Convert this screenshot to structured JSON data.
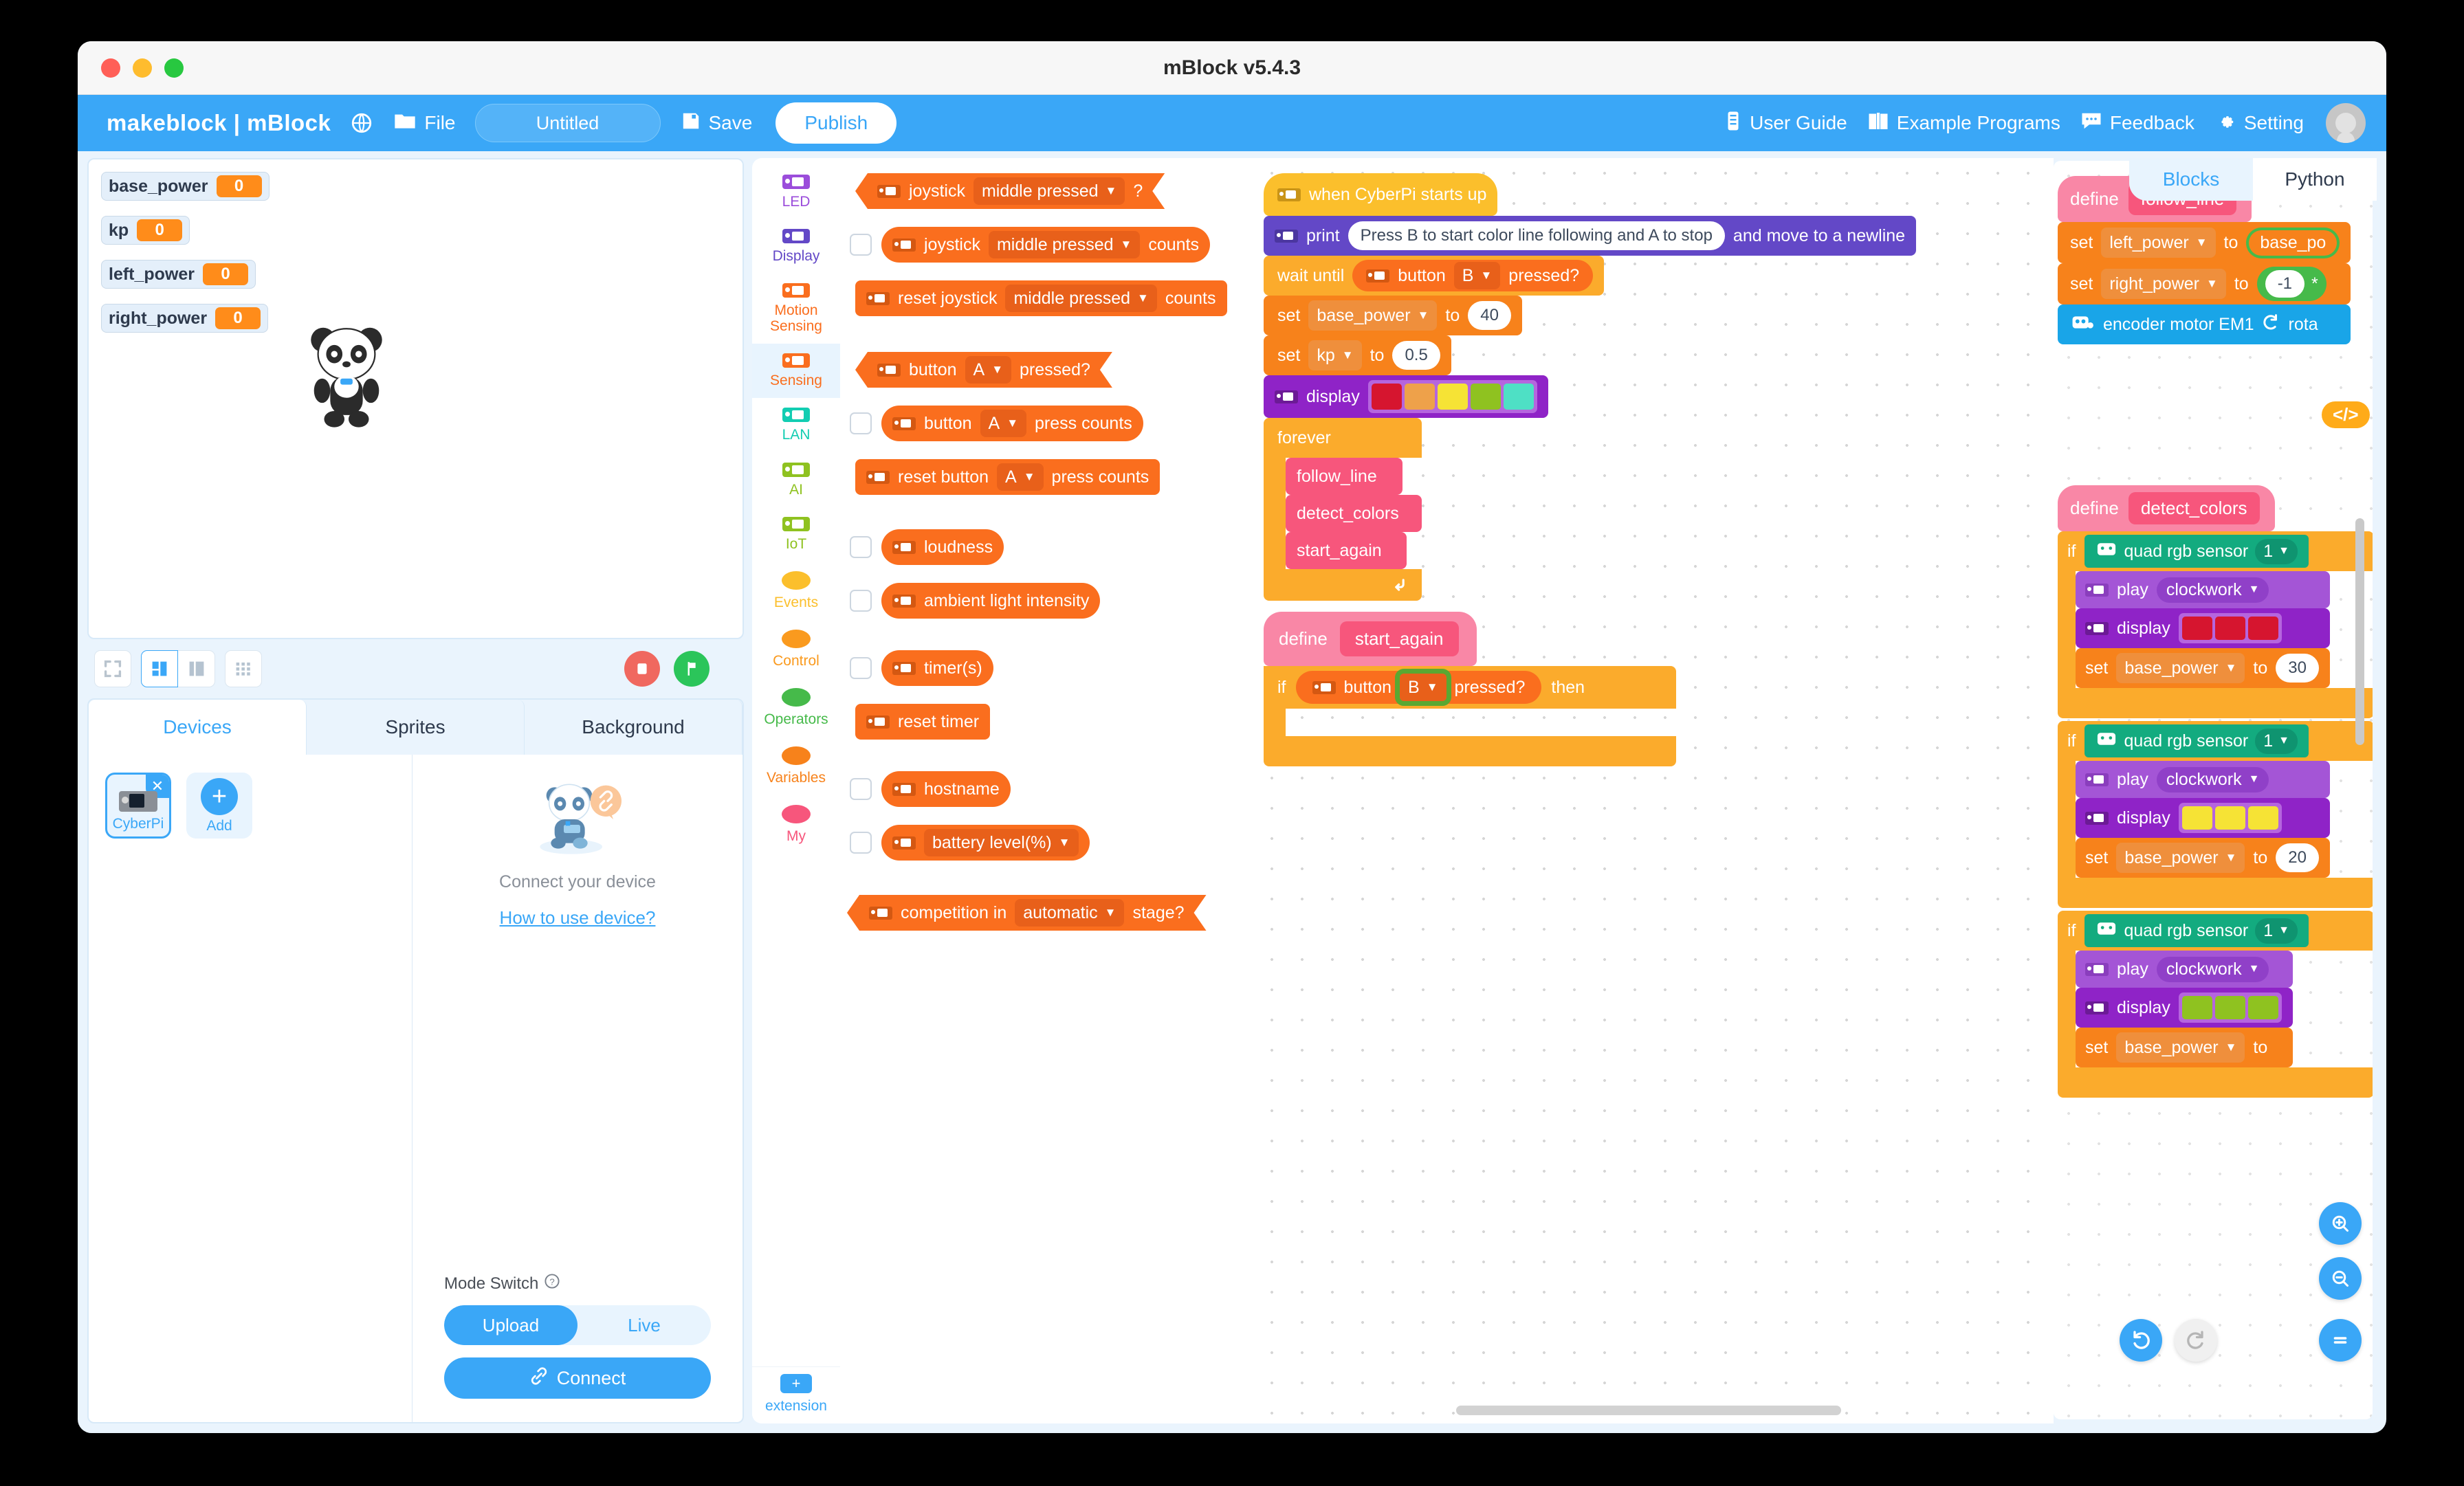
{
  "window": {
    "title": "mBlock v5.4.3"
  },
  "header": {
    "brand": "makeblock | mBlock",
    "globe_icon": "globe-icon",
    "file_icon": "folder-icon",
    "file_label": "File",
    "project_name": "Untitled",
    "project_placeholder": "Untitled",
    "save_icon": "save-icon",
    "save_label": "Save",
    "publish_label": "Publish",
    "right_items": [
      {
        "icon": "document-icon",
        "label": "User Guide"
      },
      {
        "icon": "book-icon",
        "label": "Example Programs"
      },
      {
        "icon": "chat-icon",
        "label": "Feedback"
      },
      {
        "icon": "gear-icon",
        "label": "Setting"
      }
    ]
  },
  "stage": {
    "monitors": [
      {
        "name": "base_power",
        "value": "0"
      },
      {
        "name": "kp",
        "value": "0"
      },
      {
        "name": "left_power",
        "value": "0"
      },
      {
        "name": "right_power",
        "value": "0"
      }
    ],
    "sprite": "panda-sprite",
    "controls": {
      "fullscreen_icon": "fullscreen-icon",
      "layout_small_icon": "layout-small-icon",
      "layout_large_icon": "layout-large-icon",
      "grid_icon": "grid-icon",
      "stop_icon": "stop-icon",
      "flag_icon": "green-flag-icon"
    }
  },
  "panel": {
    "tabs": [
      {
        "label": "Devices",
        "active": true
      },
      {
        "label": "Sprites",
        "active": false
      },
      {
        "label": "Background",
        "active": false
      }
    ],
    "devices": [
      {
        "label": "CyberPi",
        "selected": true,
        "close_icon": "close-icon"
      }
    ],
    "add_label": "Add",
    "connect_text": "Connect your device",
    "how_link": "How to use device?",
    "mode_label": "Mode Switch",
    "mode_help_icon": "question-circle-icon",
    "mode_options": [
      {
        "label": "Upload",
        "active": true
      },
      {
        "label": "Live",
        "active": false
      }
    ],
    "connect_button": "Connect",
    "connect_icon": "link-icon"
  },
  "categories": [
    {
      "label": "LED",
      "color": "#9b4ddb",
      "shape": "chip",
      "active": false
    },
    {
      "label": "Display",
      "color": "#6348c7",
      "shape": "chip",
      "active": false
    },
    {
      "label": "Motion\nSensing",
      "color": "#fa6e1e",
      "shape": "chip",
      "active": false
    },
    {
      "label": "Sensing",
      "color": "#fa6e1e",
      "shape": "chip",
      "active": true
    },
    {
      "label": "LAN",
      "color": "#12cdb2",
      "shape": "chip",
      "active": false
    },
    {
      "label": "AI",
      "color": "#8fc220",
      "shape": "chip",
      "active": false
    },
    {
      "label": "IoT",
      "color": "#8fc220",
      "shape": "chip",
      "active": false
    },
    {
      "label": "Events",
      "color": "#fbbf2c",
      "shape": "oval",
      "active": false
    },
    {
      "label": "Control",
      "color": "#fa9a1e",
      "shape": "oval",
      "active": false
    },
    {
      "label": "Operators",
      "color": "#46ba4a",
      "shape": "oval",
      "active": false
    },
    {
      "label": "Variables",
      "color": "#f7821b",
      "shape": "oval",
      "active": false
    },
    {
      "label": "My",
      "color": "#f7567c",
      "shape": "oval",
      "active": false
    }
  ],
  "extension": {
    "label": "extension",
    "icon": "plus-icon"
  },
  "palette": {
    "blocks": [
      {
        "kind": "bool",
        "checkbox": false,
        "parts": [
          {
            "t": "icon"
          },
          {
            "t": "text",
            "v": "joystick"
          },
          {
            "t": "dd",
            "v": "middle pressed"
          },
          {
            "t": "text",
            "v": "?"
          }
        ]
      },
      {
        "kind": "report",
        "checkbox": true,
        "parts": [
          {
            "t": "icon"
          },
          {
            "t": "text",
            "v": "joystick"
          },
          {
            "t": "dd",
            "v": "middle pressed"
          },
          {
            "t": "text",
            "v": "counts"
          }
        ]
      },
      {
        "kind": "stack",
        "checkbox": false,
        "parts": [
          {
            "t": "icon"
          },
          {
            "t": "text",
            "v": "reset joystick"
          },
          {
            "t": "dd",
            "v": "middle pressed"
          },
          {
            "t": "text",
            "v": "counts"
          }
        ]
      },
      {
        "kind": "bool",
        "checkbox": false,
        "parts": [
          {
            "t": "icon"
          },
          {
            "t": "text",
            "v": "button"
          },
          {
            "t": "dd",
            "v": "A"
          },
          {
            "t": "text",
            "v": "pressed?"
          }
        ]
      },
      {
        "kind": "report",
        "checkbox": true,
        "parts": [
          {
            "t": "icon"
          },
          {
            "t": "text",
            "v": "button"
          },
          {
            "t": "dd",
            "v": "A"
          },
          {
            "t": "text",
            "v": "press counts"
          }
        ]
      },
      {
        "kind": "stack",
        "checkbox": false,
        "parts": [
          {
            "t": "icon"
          },
          {
            "t": "text",
            "v": "reset button"
          },
          {
            "t": "dd",
            "v": "A"
          },
          {
            "t": "text",
            "v": "press counts"
          }
        ]
      },
      {
        "kind": "report",
        "checkbox": true,
        "parts": [
          {
            "t": "icon"
          },
          {
            "t": "text",
            "v": "loudness"
          }
        ]
      },
      {
        "kind": "report",
        "checkbox": true,
        "parts": [
          {
            "t": "icon"
          },
          {
            "t": "text",
            "v": "ambient light intensity"
          }
        ]
      },
      {
        "kind": "report",
        "checkbox": true,
        "parts": [
          {
            "t": "icon"
          },
          {
            "t": "text",
            "v": "timer(s)"
          }
        ]
      },
      {
        "kind": "stack",
        "checkbox": false,
        "parts": [
          {
            "t": "icon"
          },
          {
            "t": "text",
            "v": "reset timer"
          }
        ]
      },
      {
        "kind": "report",
        "checkbox": true,
        "parts": [
          {
            "t": "icon"
          },
          {
            "t": "text",
            "v": "hostname"
          }
        ]
      },
      {
        "kind": "report",
        "checkbox": true,
        "parts": [
          {
            "t": "icon"
          },
          {
            "t": "dd",
            "v": "battery level(%)"
          }
        ]
      },
      {
        "kind": "bool",
        "checkbox": false,
        "parts": [
          {
            "t": "icon"
          },
          {
            "t": "text",
            "v": "competition in"
          },
          {
            "t": "dd",
            "v": "automatic"
          },
          {
            "t": "text",
            "v": "stage?"
          }
        ]
      }
    ]
  },
  "workspace": {
    "script1": {
      "hat": "when CyberPi starts up",
      "print_label": "print",
      "print_value": "Press B to start color line following and A to stop",
      "print_suffix": "and move to a newline",
      "wait_label": "wait until",
      "wait_button": "button",
      "wait_key": "B",
      "wait_pressed": "pressed?",
      "set1_label": "set",
      "set1_var": "base_power",
      "set1_to": "to",
      "set1_val": "40",
      "set2_label": "set",
      "set2_var": "kp",
      "set2_to": "to",
      "set2_val": "0.5",
      "display_label": "display",
      "display_colors": [
        "#d6152f",
        "#eea14a",
        "#f6e335",
        "#8fc220",
        "#4ee0c5"
      ],
      "forever_label": "forever",
      "calls": [
        "follow_line",
        "detect_colors",
        "start_again"
      ]
    },
    "script2": {
      "define_label": "define",
      "proc_name": "start_again",
      "if_label": "if",
      "if_button": "button",
      "if_key": "B",
      "if_pressed": "pressed?",
      "if_then": "then",
      "highlighted_field": "if_key"
    }
  },
  "code_panel": {
    "tabs": [
      {
        "label": "Blocks",
        "active": true
      },
      {
        "label": "Python",
        "active": false
      }
    ],
    "script_follow_line": {
      "define_label": "define",
      "proc_name": "follow_line",
      "rows": [
        {
          "label": "set",
          "var": "left_power",
          "to": "to",
          "val": "base_po"
        },
        {
          "label": "set",
          "var": "right_power",
          "to": "to",
          "val": "-1"
        }
      ],
      "motor_block": "encoder motor EM1",
      "motor_suffix": "rota",
      "code_badge": "</>"
    },
    "script_detect_colors": {
      "define_label": "define",
      "proc_name": "detect_colors",
      "branches": [
        {
          "if": "if",
          "sensor": "quad rgb sensor",
          "port": "1",
          "play": "play",
          "sound": "clockwork",
          "display": "display",
          "colors": [
            "#d6152f",
            "#d6152f",
            "#d6152f"
          ],
          "set": "set",
          "var": "base_power",
          "to": "to",
          "val": "30"
        },
        {
          "if": "if",
          "sensor": "quad rgb sensor",
          "port": "1",
          "play": "play",
          "sound": "clockwork",
          "display": "display",
          "colors": [
            "#f6e335",
            "#f6e335",
            "#f6e335"
          ],
          "set": "set",
          "var": "base_power",
          "to": "to",
          "val": "20"
        },
        {
          "if": "if",
          "sensor": "quad rgb sensor",
          "port": "1",
          "play": "play",
          "sound": "clockwork",
          "display": "display",
          "colors": [
            "#8fc220",
            "#8fc220",
            "#8fc220"
          ],
          "set": "set",
          "var": "base_power",
          "to": "to",
          "val": ""
        }
      ]
    },
    "fabs": [
      {
        "icon": "zoom-in-icon"
      },
      {
        "icon": "zoom-out-icon"
      },
      {
        "icon": "undo-icon"
      },
      {
        "icon": "redo-icon"
      },
      {
        "icon": "equals-icon"
      }
    ]
  },
  "colors": {
    "accent": "#3aa7f7",
    "sensing": "#fa6e1e",
    "events": "#fbbf2c",
    "control": "#fa9a1e",
    "variables": "#f7821b",
    "my_blocks": "#f7567c",
    "display_purple": "#8f23c7",
    "led_purple": "#9b4ddb",
    "operators_green": "#46ba4a",
    "lan_teal": "#12cdb2",
    "motor_blue": "#19a5e8",
    "highlight_green": "#5aa832"
  }
}
